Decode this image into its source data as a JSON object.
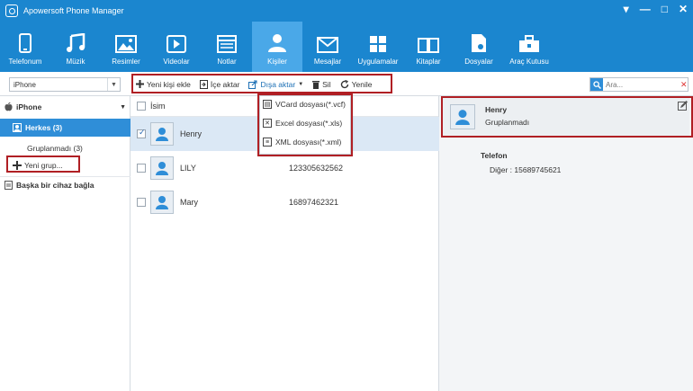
{
  "app": {
    "title": "Apowersoft Phone Manager"
  },
  "window_controls": [
    "▾",
    "—",
    "□",
    "✕"
  ],
  "nav": [
    {
      "label": "Telefonum",
      "icon": "phone-icon",
      "active": false
    },
    {
      "label": "Müzik",
      "icon": "music-icon",
      "active": false
    },
    {
      "label": "Resimler",
      "icon": "picture-icon",
      "active": false
    },
    {
      "label": "Videolar",
      "icon": "video-icon",
      "active": false
    },
    {
      "label": "Notlar",
      "icon": "notes-icon",
      "active": false
    },
    {
      "label": "Kişiler",
      "icon": "contacts-icon",
      "active": true
    },
    {
      "label": "Mesajlar",
      "icon": "messages-icon",
      "active": false
    },
    {
      "label": "Uygulamalar",
      "icon": "apps-icon",
      "active": false
    },
    {
      "label": "Kitaplar",
      "icon": "books-icon",
      "active": false
    },
    {
      "label": "Dosyalar",
      "icon": "files-icon",
      "active": false
    },
    {
      "label": "Araç Kutusu",
      "icon": "toolbox-icon",
      "active": false
    }
  ],
  "toolbar": {
    "device_select": "iPhone",
    "actions": {
      "new_contact": "Yeni kişi ekle",
      "import": "İçe aktar",
      "export": "Dışa aktar",
      "delete": "Sil",
      "refresh": "Yenile"
    },
    "search_placeholder": "Ara..."
  },
  "sidebar": {
    "device": "iPhone",
    "everyone": "Herkes (3)",
    "ungrouped": "Gruplanmadı (3)",
    "new_group": "Yeni grup...",
    "connect_other": "Başka bir cihaz bağla"
  },
  "list": {
    "header": "İsim",
    "rows": [
      {
        "name": "Henry",
        "phone": "",
        "selected": true
      },
      {
        "name": "LILY",
        "phone": "123305632562",
        "selected": false
      },
      {
        "name": "Mary",
        "phone": "16897462321",
        "selected": false
      }
    ]
  },
  "export_menu": [
    {
      "label": "VCard dosyası(*.vcf)",
      "icon": "vcard-icon"
    },
    {
      "label": "Excel dosyası(*.xls)",
      "icon": "excel-icon"
    },
    {
      "label": "XML dosyası(*.xml)",
      "icon": "xml-icon"
    }
  ],
  "detail": {
    "name": "Henry",
    "group": "Gruplanmadı",
    "phone_section": "Telefon",
    "phone_entry": "Diğer : 15689745621"
  },
  "colors": {
    "nav_bg": "#1b86cf",
    "nav_active": "#4aa8e8",
    "highlight_box": "#b01f24",
    "selected_row": "#dbe8f5"
  }
}
